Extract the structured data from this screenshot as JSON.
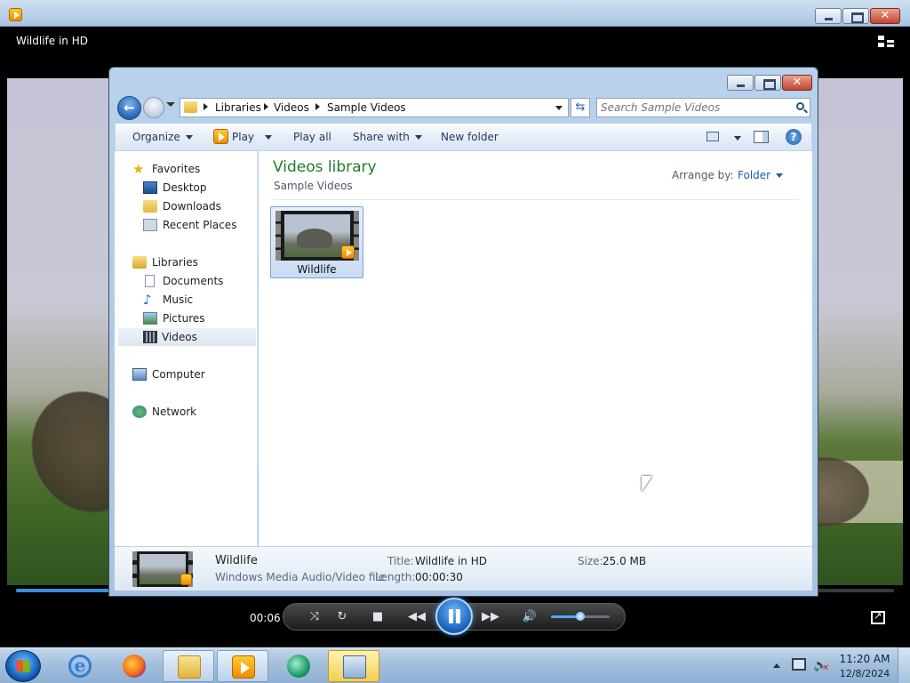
{
  "wmp": {
    "now_playing_title": "Wildlife in HD",
    "elapsed_time": "00:06",
    "seek_progress": 0.11,
    "volume_level": 0.5
  },
  "explorer": {
    "breadcrumb": [
      "Libraries",
      "Videos",
      "Sample Videos"
    ],
    "search_placeholder": "Search Sample Videos",
    "commands": {
      "organize": "Organize",
      "play": "Play",
      "play_all": "Play all",
      "share_with": "Share with",
      "new_folder": "New folder"
    },
    "nav": {
      "favorites": "Favorites",
      "desktop": "Desktop",
      "downloads": "Downloads",
      "recent_places": "Recent Places",
      "libraries": "Libraries",
      "documents": "Documents",
      "music": "Music",
      "pictures": "Pictures",
      "videos": "Videos",
      "computer": "Computer",
      "network": "Network"
    },
    "content": {
      "library_title": "Videos library",
      "library_subtitle": "Sample Videos",
      "arrange_label": "Arrange by:",
      "arrange_value": "Folder",
      "files": [
        {
          "name": "Wildlife"
        }
      ]
    },
    "details": {
      "name": "Wildlife",
      "type": "Windows Media Audio/Video file",
      "title_label": "Title:",
      "title_value": "Wildlife in HD",
      "length_label": "Length:",
      "length_value": "00:00:30",
      "size_label": "Size:",
      "size_value": "25.0 MB"
    }
  },
  "taskbar": {
    "clock_time": "11:20 AM",
    "clock_date": "12/8/2024"
  },
  "colors": {
    "library_title": "#1f7c29",
    "link_blue": "#1e5ea8",
    "accent_blue": "#3b8fd8"
  }
}
